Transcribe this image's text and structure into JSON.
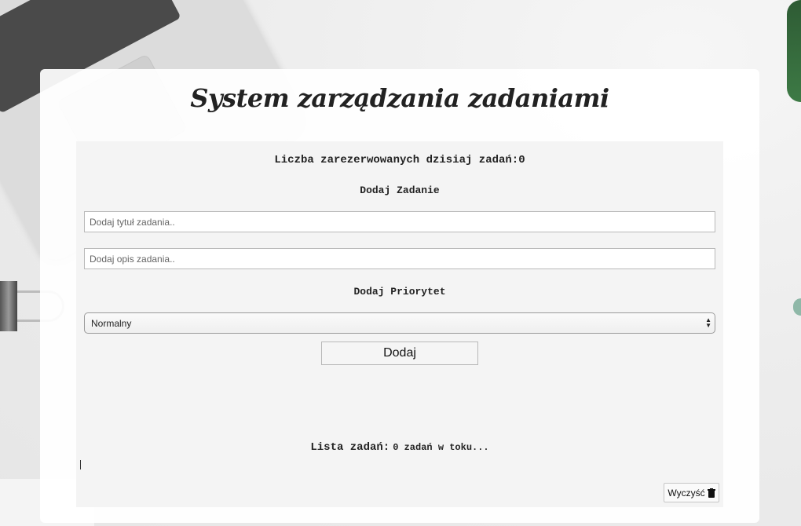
{
  "header": {
    "title": "System zarządzania zadaniami"
  },
  "summary": {
    "count_text": "Liczba zarezerwowanych dzisiaj zadań:0"
  },
  "add_task": {
    "heading": "Dodaj Zadanie",
    "title_placeholder": "Dodaj tytuł zadania..",
    "title_value": "",
    "description_placeholder": "Dodaj opis zadania..",
    "description_value": ""
  },
  "priority": {
    "heading": "Dodaj Priorytet",
    "selected": "Normalny"
  },
  "actions": {
    "add_label": "Dodaj",
    "clear_label": "Wyczyść"
  },
  "task_list": {
    "label": "Lista zadań:",
    "status": "0 zadań w toku..."
  },
  "icons": {
    "clear": "trash-icon",
    "select": "chevron-updown-icon"
  }
}
